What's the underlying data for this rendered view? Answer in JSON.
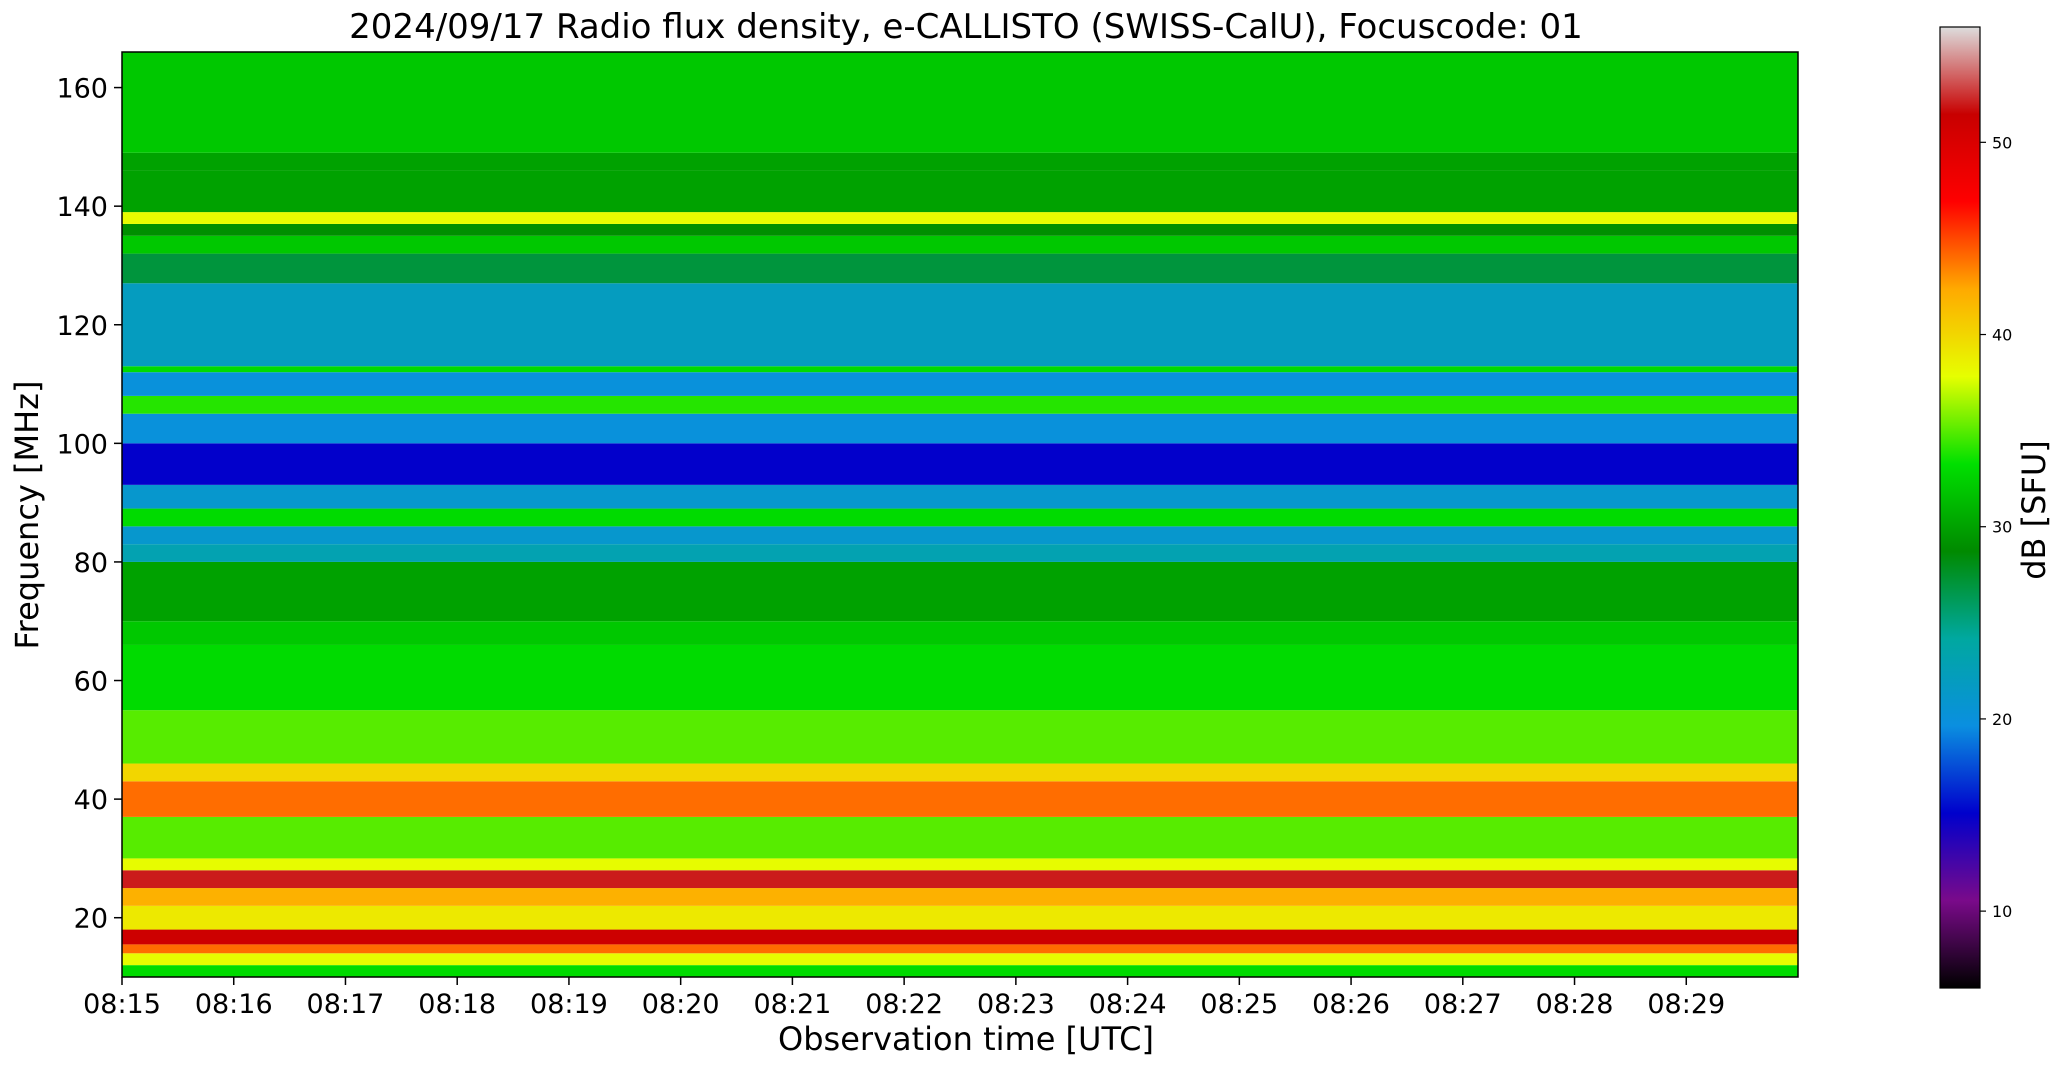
{
  "chart_data": {
    "type": "heatmap",
    "title": "2024/09/17  Radio flux density, e-CALLISTO (SWISS-CalU), Focuscode: 01",
    "xlabel": "Observation time [UTC]",
    "ylabel": "Frequency [MHz]",
    "xlim": [
      "08:15",
      "08:30"
    ],
    "ylim": [
      10,
      166
    ],
    "x_ticks": [
      "08:15",
      "08:16",
      "08:17",
      "08:18",
      "08:19",
      "08:20",
      "08:21",
      "08:22",
      "08:23",
      "08:24",
      "08:25",
      "08:26",
      "08:27",
      "08:28",
      "08:29"
    ],
    "y_ticks": [
      20,
      40,
      60,
      80,
      100,
      120,
      140,
      160
    ],
    "colorbar": {
      "label": "dB [SFU]",
      "range": [
        6,
        56
      ],
      "ticks": [
        10,
        20,
        30,
        40,
        50
      ],
      "colormap": [
        "#000000",
        "#7a0a8a",
        "#0000cc",
        "#0a8fe0",
        "#00a8a0",
        "#008a00",
        "#00e000",
        "#e6ff00",
        "#ffaa00",
        "#ff0000",
        "#c80000",
        "#dddddd"
      ]
    },
    "bands": [
      {
        "f0": 10,
        "f1": 12,
        "db": 33
      },
      {
        "f0": 12,
        "f1": 14,
        "db": 38
      },
      {
        "f0": 14,
        "f1": 15.5,
        "db": 44
      },
      {
        "f0": 15.5,
        "f1": 18,
        "db": 51
      },
      {
        "f0": 18,
        "f1": 22,
        "db": 39
      },
      {
        "f0": 22,
        "f1": 25,
        "db": 42
      },
      {
        "f0": 25,
        "f1": 28,
        "db": 52
      },
      {
        "f0": 28,
        "f1": 30,
        "db": 38
      },
      {
        "f0": 30,
        "f1": 37,
        "db": 35
      },
      {
        "f0": 37,
        "f1": 43,
        "db": 44
      },
      {
        "f0": 43,
        "f1": 46,
        "db": 40
      },
      {
        "f0": 46,
        "f1": 55,
        "db": 35
      },
      {
        "f0": 55,
        "f1": 66,
        "db": 33
      },
      {
        "f0": 66,
        "f1": 70,
        "db": 32
      },
      {
        "f0": 70,
        "f1": 80,
        "db": 30
      },
      {
        "f0": 80,
        "f1": 83,
        "db": 23
      },
      {
        "f0": 83,
        "f1": 86,
        "db": 21
      },
      {
        "f0": 86,
        "f1": 89,
        "db": 33
      },
      {
        "f0": 89,
        "f1": 93,
        "db": 21
      },
      {
        "f0": 93,
        "f1": 100,
        "db": 15
      },
      {
        "f0": 100,
        "f1": 105,
        "db": 20
      },
      {
        "f0": 105,
        "f1": 108,
        "db": 34
      },
      {
        "f0": 108,
        "f1": 112,
        "db": 20
      },
      {
        "f0": 112,
        "f1": 113,
        "db": 33
      },
      {
        "f0": 113,
        "f1": 127,
        "db": 22
      },
      {
        "f0": 127,
        "f1": 132,
        "db": 27
      },
      {
        "f0": 132,
        "f1": 135,
        "db": 32
      },
      {
        "f0": 135,
        "f1": 137,
        "db": 29
      },
      {
        "f0": 137,
        "f1": 139,
        "db": 38
      },
      {
        "f0": 139,
        "f1": 146,
        "db": 30
      },
      {
        "f0": 146,
        "f1": 149,
        "db": 30
      },
      {
        "f0": 149,
        "f1": 166,
        "db": 32
      }
    ],
    "grid": false
  }
}
